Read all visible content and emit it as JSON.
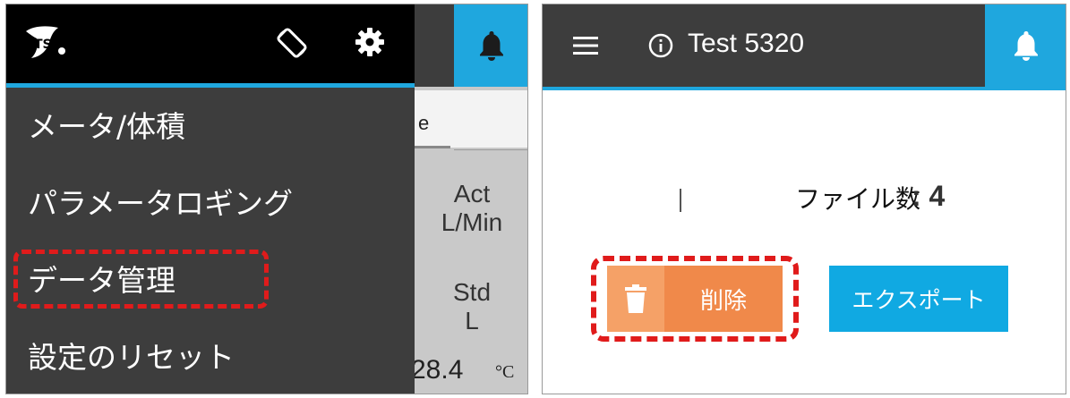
{
  "left": {
    "menu_items": [
      "メータ/体積",
      "パラメータロギング",
      "データ管理",
      "設定のリセット"
    ],
    "background": {
      "tab_fragment": "e",
      "header1_line1": "Act",
      "header1_line2": "L/Min",
      "header2_line1": "Std",
      "header2_line2": "L",
      "value": "28.4",
      "unit": "°C"
    }
  },
  "right": {
    "title": "Test 5320",
    "file_count_label": "ファイル数",
    "file_count_value": ": 4",
    "delete_label": "削除",
    "export_label": "エクスポート"
  },
  "colors": {
    "accent_blue": "#1fa7de",
    "appbar_dark": "#3d3d3d",
    "delete_orange": "#f0894a",
    "highlight_red": "#e01b1b"
  },
  "icons": [
    "tsi-logo",
    "screen-rotation-icon",
    "gear-icon",
    "bell-icon",
    "hamburger-menu-icon",
    "info-icon",
    "trash-icon"
  ]
}
